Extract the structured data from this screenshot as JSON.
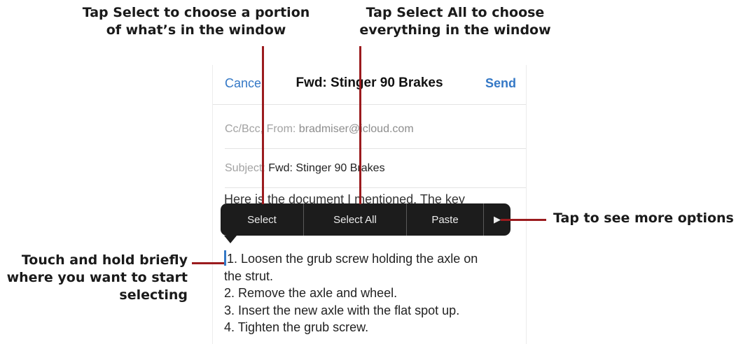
{
  "callouts": {
    "select": {
      "line1": "Tap Select to choose a portion",
      "line2": "of what’s in the window"
    },
    "select_all": {
      "line1": "Tap Select All to choose",
      "line2": "everything in the window"
    },
    "more": {
      "text": "Tap to see more options"
    },
    "touch": {
      "line1": "Touch and hold briefly",
      "line2": "where you want to start",
      "line3": "selecting"
    }
  },
  "nav": {
    "cancel_label": "Cancel",
    "title": "Fwd: Stinger 90 Brakes",
    "send_label": "Send"
  },
  "cc_field": {
    "label": "Cc/Bcc, From:",
    "value": "bradmiser@icloud.com"
  },
  "subject_field": {
    "label": "Subject:",
    "value": "Fwd: Stinger 90 Brakes"
  },
  "body": {
    "partial_line": "Here is the document I mentioned. The key",
    "lines": [
      "1. Loosen the grub screw holding the axle on",
      "the strut.",
      "2. Remove the axle and wheel.",
      "3. Insert the new axle with the flat spot up.",
      "4. Tighten the grub screw."
    ]
  },
  "edit_menu": {
    "items": [
      "Select",
      "Select All",
      "Paste"
    ],
    "more_icon": "triangle-right-icon"
  },
  "colors": {
    "accent": "#3478c6",
    "callout_line": "#9b1b1e",
    "menu_bg": "#1c1c1c"
  }
}
